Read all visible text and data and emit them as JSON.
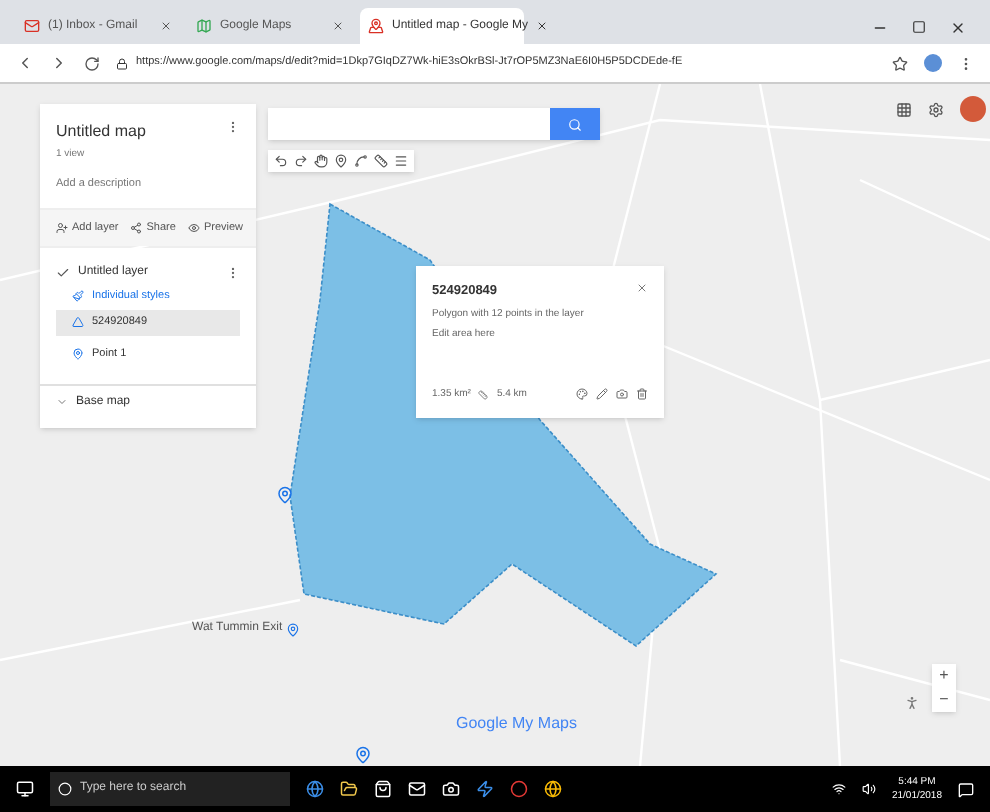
{
  "browser": {
    "tabs": [
      {
        "kind": "mail",
        "title": "(1) Inbox - Gmail",
        "selected": false
      },
      {
        "kind": "maps",
        "title": "Google Maps",
        "selected": false
      },
      {
        "kind": "mymaps",
        "title": "Untitled map - Google My",
        "selected": true
      }
    ],
    "url": "https://www.google.com/maps/d/edit?mid=1Dkp7GIqDZ7Wk-hiE3sOkrBSl-Jt7rOP5MZ3NaE6I0H5P5DCDEde-fE"
  },
  "panel": {
    "title": "Untitled map",
    "subtitle": "1 view",
    "description": "Add a description",
    "actions": [
      {
        "kind": "layer",
        "label": "Add layer"
      },
      {
        "kind": "share",
        "label": "Share"
      },
      {
        "kind": "preview",
        "label": "Preview"
      }
    ],
    "layer": {
      "title": "Untitled layer",
      "checked": true,
      "style": "Individual styles",
      "items": [
        {
          "kind": "polygon",
          "label": "524920849",
          "selected": true
        },
        {
          "kind": "point",
          "label": "Point 1",
          "selected": false
        }
      ]
    },
    "base_map": "Base map"
  },
  "popup": {
    "title": "524920849",
    "lines": [
      "Polygon with 12 points in the layer",
      "Edit area here"
    ],
    "area": "1.35 km²",
    "perimeter": "5.4 km"
  },
  "place_label": "Wat Tummin Exit",
  "brand": "Google My Maps",
  "zoom": [
    "+",
    "−"
  ],
  "taskbar": {
    "search": "Type here to search",
    "time": "5:44 PM",
    "date": "21/01/2018"
  }
}
